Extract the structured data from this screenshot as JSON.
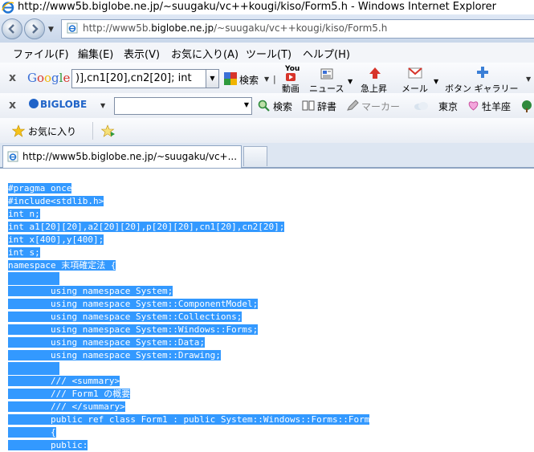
{
  "window": {
    "title": "http://www5b.biglobe.ne.jp/~suugaku/vc++kougi/kiso/Form5.h - Windows Internet Explorer"
  },
  "address": {
    "url_prefix": "http://www5b.",
    "url_host": "biglobe.ne.jp",
    "url_path": "/~suugaku/vc++kougi/kiso/Form5.h"
  },
  "menu": [
    "ファイル(F)",
    "編集(E)",
    "表示(V)",
    "お気に入り(A)",
    "ツール(T)",
    "ヘルプ(H)"
  ],
  "google_bar": {
    "logo": "Google",
    "query": ")],cn1[20],cn2[20]; int",
    "search_label": "検索",
    "buttons": [
      {
        "top": "You",
        "label": "動画"
      },
      {
        "label": "ニュース"
      },
      {
        "label": "急上昇"
      },
      {
        "label": "メール"
      },
      {
        "label": "ボタン ギャラリー"
      }
    ]
  },
  "biglobe_bar": {
    "logo": "BIGLOBE",
    "search_label": "検索",
    "dictionary_label": "辞書",
    "marker_label": "マーカー",
    "weather_label": "東京",
    "horoscope_label": "牡羊座"
  },
  "favorites_bar": {
    "favorites_label": "お気に入り"
  },
  "tab": {
    "label": "http://www5b.biglobe.ne.jp/~suugaku/vc+..."
  },
  "code_lines": [
    "#pragma once",
    "#include<stdlib.h>",
    "int n;",
    "int a1[20][20],a2[20][20],p[20][20],cn1[20],cn2[20];",
    "int x[400],y[400];",
    "int s;",
    "namespace 末項確定法 {",
    "",
    "        using namespace System;",
    "        using namespace System::ComponentModel;",
    "        using namespace System::Collections;",
    "        using namespace System::Windows::Forms;",
    "        using namespace System::Data;",
    "        using namespace System::Drawing;",
    "",
    "        /// <summary>",
    "        /// Form1 の概要",
    "        /// </summary>",
    "        public ref class Form1 : public System::Windows::Forms::Form",
    "        {",
    "        public:"
  ]
}
